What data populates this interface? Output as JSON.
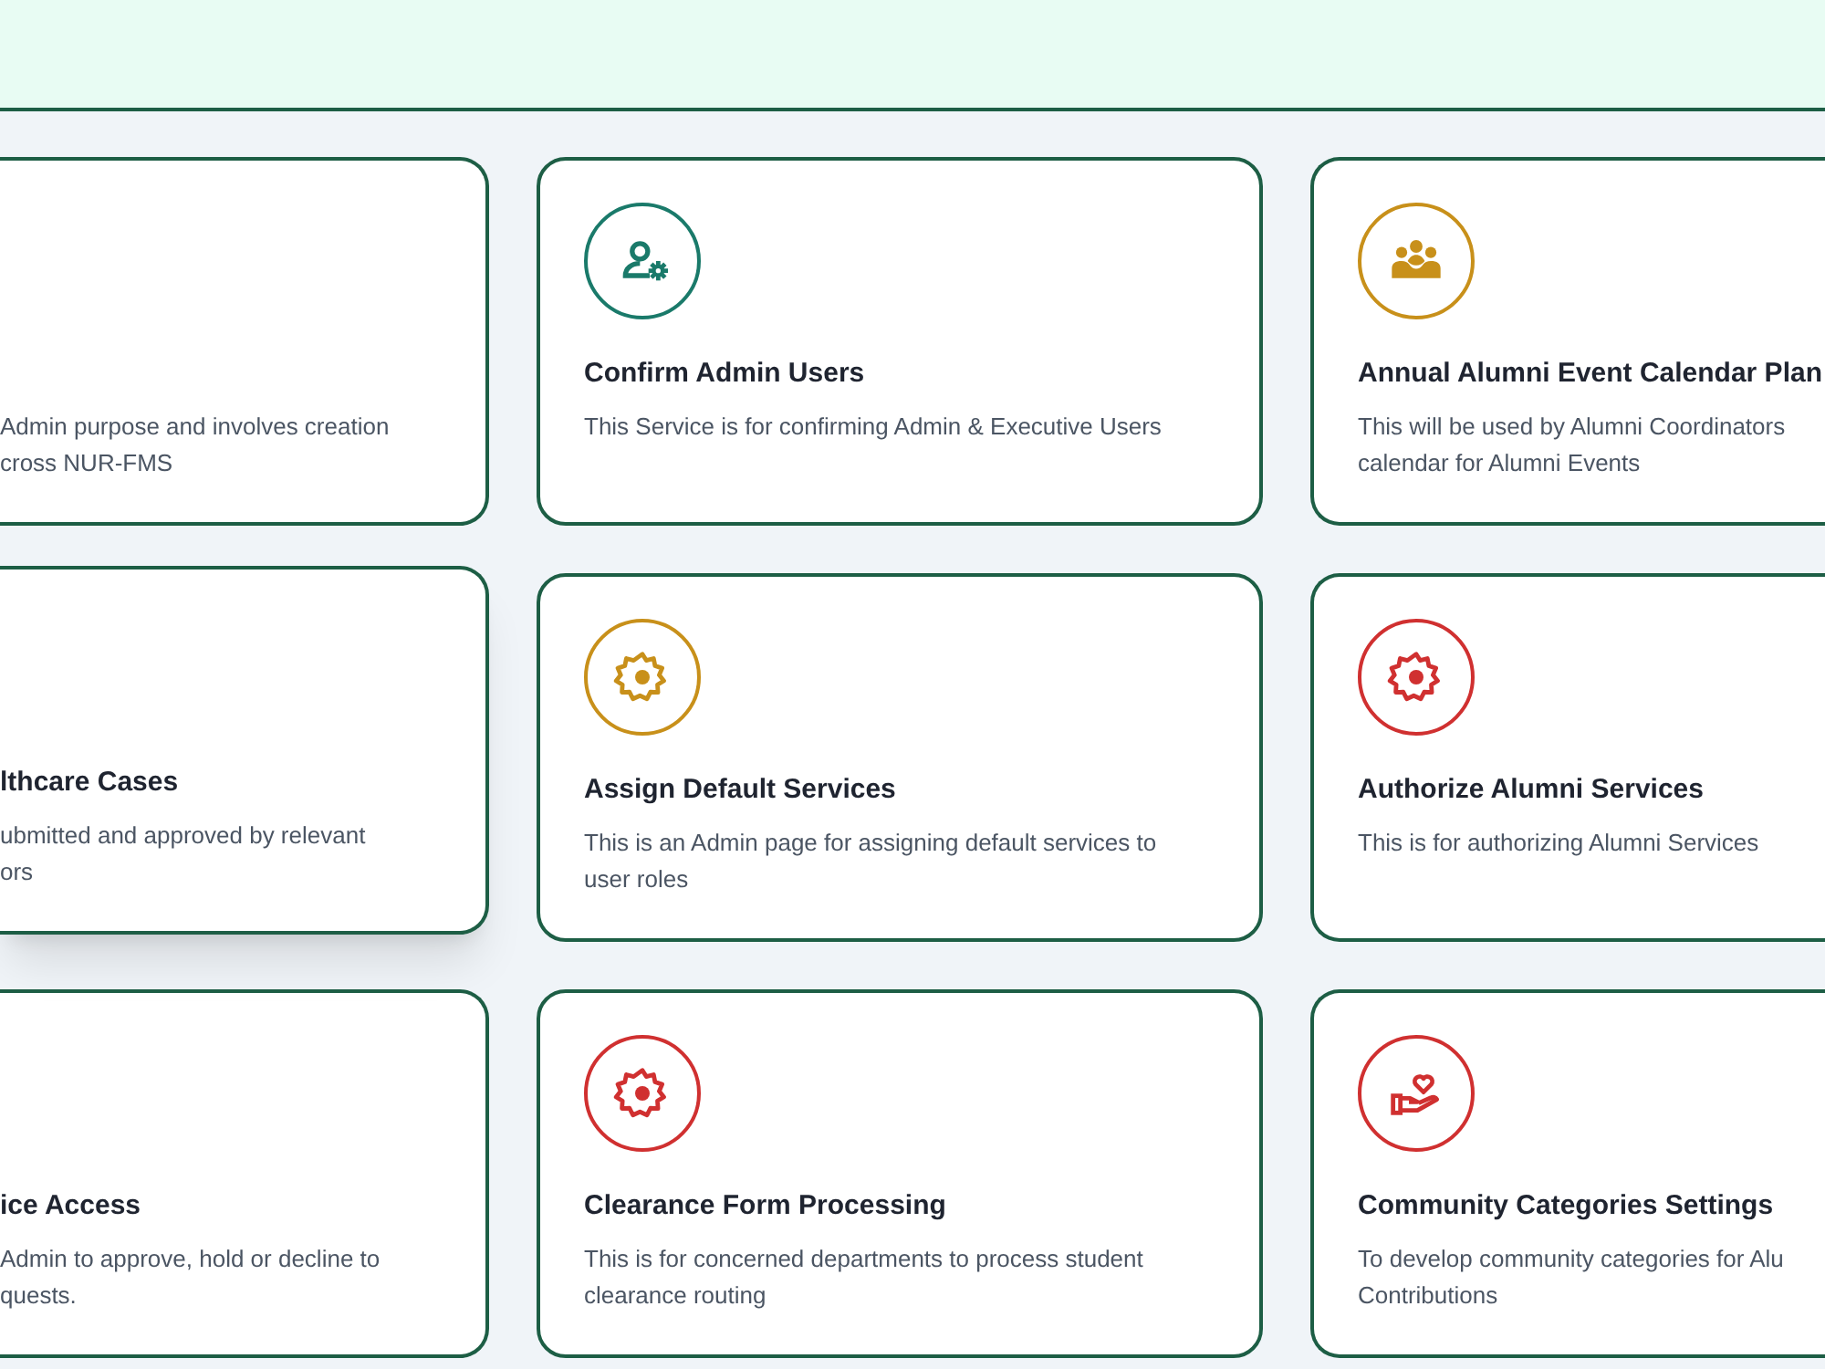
{
  "cards": [
    {
      "kind": "cut_left",
      "hovered": false,
      "description_lines": [
        "Admin purpose and involves creation",
        "cross NUR-FMS"
      ]
    },
    {
      "kind": "cut_left",
      "hovered": true,
      "title": "lthcare Cases",
      "description_lines": [
        "ubmitted and approved by relevant",
        "ors"
      ]
    },
    {
      "kind": "cut_left",
      "hovered": false,
      "title": "ice Access",
      "description_lines": [
        "Admin to approve, hold or decline to",
        "quests."
      ]
    },
    {
      "kind": "full",
      "hovered": false,
      "color": "#1a7a6a",
      "title": "Confirm Admin Users",
      "description_lines": [
        "This Service is for confirming Admin & Executive Users"
      ]
    },
    {
      "kind": "full",
      "hovered": false,
      "color": "#c8901a",
      "title": "Assign Default Services",
      "description_lines": [
        "This is an Admin page for assigning default services to",
        "user roles"
      ]
    },
    {
      "kind": "full",
      "hovered": false,
      "color": "#d03030",
      "title": "Clearance Form Processing",
      "description_lines": [
        "This is for concerned departments to process student",
        "clearance routing"
      ]
    },
    {
      "kind": "cut_right",
      "hovered": false,
      "color": "#c8901a",
      "title": "Annual Alumni Event Calendar Plan",
      "description_lines": [
        "This will be used by Alumni Coordinators",
        "calendar for Alumni Events"
      ]
    },
    {
      "kind": "cut_right",
      "hovered": false,
      "color": "#d03030",
      "title": "Authorize Alumni Services",
      "description_lines": [
        "This is for authorizing Alumni Services"
      ]
    },
    {
      "kind": "cut_right",
      "hovered": false,
      "color": "#d03030",
      "title": "Community Categories Settings",
      "description_lines": [
        "To develop community categories for Alu",
        "Contributions"
      ]
    }
  ]
}
